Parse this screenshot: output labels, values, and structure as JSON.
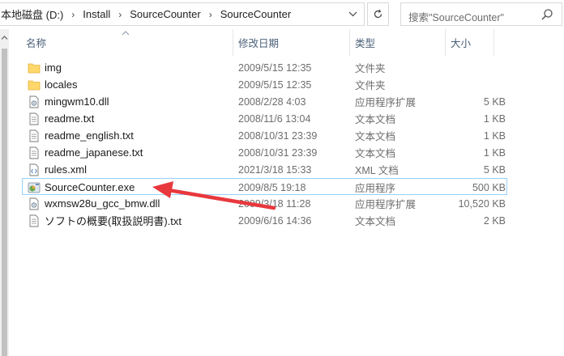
{
  "address_bar": {
    "crumbs": [
      "本地磁盘 (D:)",
      "Install",
      "SourceCounter",
      "SourceCounter"
    ],
    "separator": "›"
  },
  "search": {
    "placeholder": "搜索\"SourceCounter\""
  },
  "columns": {
    "name": "名称",
    "date": "修改日期",
    "type": "类型",
    "size": "大小"
  },
  "files": [
    {
      "name": "img",
      "date": "2009/5/15 12:35",
      "type": "文件夹",
      "size": "",
      "icon": "folder-icon"
    },
    {
      "name": "locales",
      "date": "2009/5/15 12:35",
      "type": "文件夹",
      "size": "",
      "icon": "folder-icon"
    },
    {
      "name": "mingwm10.dll",
      "date": "2008/2/28 4:03",
      "type": "应用程序扩展",
      "size": "5 KB",
      "icon": "dll-file-icon"
    },
    {
      "name": "readme.txt",
      "date": "2008/11/6 13:04",
      "type": "文本文档",
      "size": "1 KB",
      "icon": "text-file-icon"
    },
    {
      "name": "readme_english.txt",
      "date": "2008/10/31 23:39",
      "type": "文本文档",
      "size": "1 KB",
      "icon": "text-file-icon"
    },
    {
      "name": "readme_japanese.txt",
      "date": "2008/10/31 23:39",
      "type": "文本文档",
      "size": "1 KB",
      "icon": "text-file-icon"
    },
    {
      "name": "rules.xml",
      "date": "2021/3/18 15:33",
      "type": "XML 文档",
      "size": "5 KB",
      "icon": "xml-file-icon"
    },
    {
      "name": "SourceCounter.exe",
      "date": "2009/8/5 19:18",
      "type": "应用程序",
      "size": "500 KB",
      "icon": "exe-file-icon",
      "selected": true
    },
    {
      "name": "wxmsw28u_gcc_bmw.dll",
      "date": "2009/3/18 11:28",
      "type": "应用程序扩展",
      "size": "10,520 KB",
      "icon": "dll-file-icon"
    },
    {
      "name": "ソフトの概要(取扱説明書).txt",
      "date": "2009/6/16 14:36",
      "type": "文本文档",
      "size": "2 KB",
      "icon": "text-file-icon"
    }
  ],
  "colors": {
    "arrow": "#e8383d",
    "selection_border": "#99d1ff",
    "header_text": "#4c607a",
    "folder": "#ffd86b"
  }
}
